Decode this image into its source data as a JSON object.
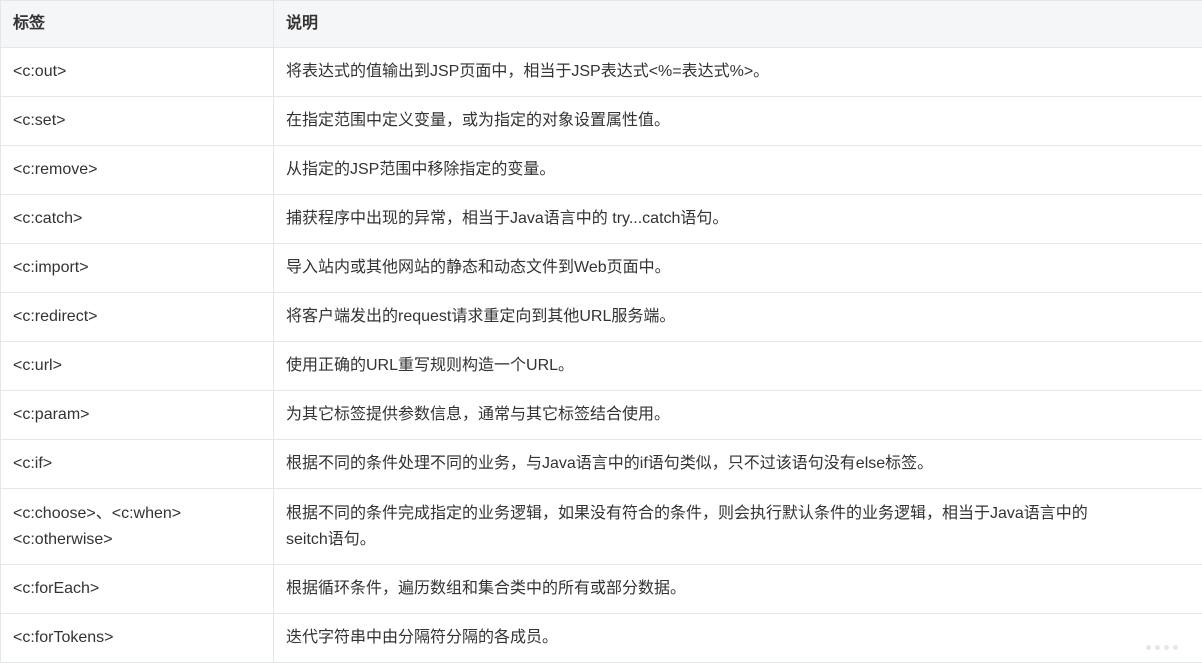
{
  "table": {
    "headers": [
      "标签",
      "说明"
    ],
    "rows": [
      {
        "tag": [
          "<c:out>"
        ],
        "desc": [
          "将表达式的值输出到JSP页面中，相当于JSP表达式<%=表达式%>。"
        ]
      },
      {
        "tag": [
          "<c:set>"
        ],
        "desc": [
          "在指定范围中定义变量，或为指定的对象设置属性值。"
        ]
      },
      {
        "tag": [
          "<c:remove>"
        ],
        "desc": [
          "从指定的JSP范围中移除指定的变量。"
        ]
      },
      {
        "tag": [
          "<c:catch>"
        ],
        "desc": [
          "捕获程序中出现的异常，相当于Java语言中的 try...catch语句。"
        ]
      },
      {
        "tag": [
          "<c:import>"
        ],
        "desc": [
          "导入站内或其他网站的静态和动态文件到Web页面中。"
        ]
      },
      {
        "tag": [
          "<c:redirect>"
        ],
        "desc": [
          "将客户端发出的request请求重定向到其他URL服务端。"
        ]
      },
      {
        "tag": [
          "<c:url>"
        ],
        "desc": [
          "使用正确的URL重写规则构造一个URL。"
        ]
      },
      {
        "tag": [
          "<c:param>"
        ],
        "desc": [
          "为其它标签提供参数信息，通常与其它标签结合使用。"
        ]
      },
      {
        "tag": [
          "<c:if>"
        ],
        "desc": [
          "根据不同的条件处理不同的业务，与Java语言中的if语句类似，只不过该语句没有else标签。"
        ]
      },
      {
        "tag": [
          "<c:choose>、<c:when>",
          "<c:otherwise>"
        ],
        "desc": [
          "根据不同的条件完成指定的业务逻辑，如果没有符合的条件，则会执行默认条件的业务逻辑，相当于Java语言中的",
          "seitch语句。"
        ]
      },
      {
        "tag": [
          "<c:forEach>"
        ],
        "desc": [
          "根据循环条件，遍历数组和集合类中的所有或部分数据。"
        ]
      },
      {
        "tag": [
          "<c:forTokens>"
        ],
        "desc": [
          "迭代字符串中由分隔符分隔的各成员。"
        ]
      }
    ]
  }
}
